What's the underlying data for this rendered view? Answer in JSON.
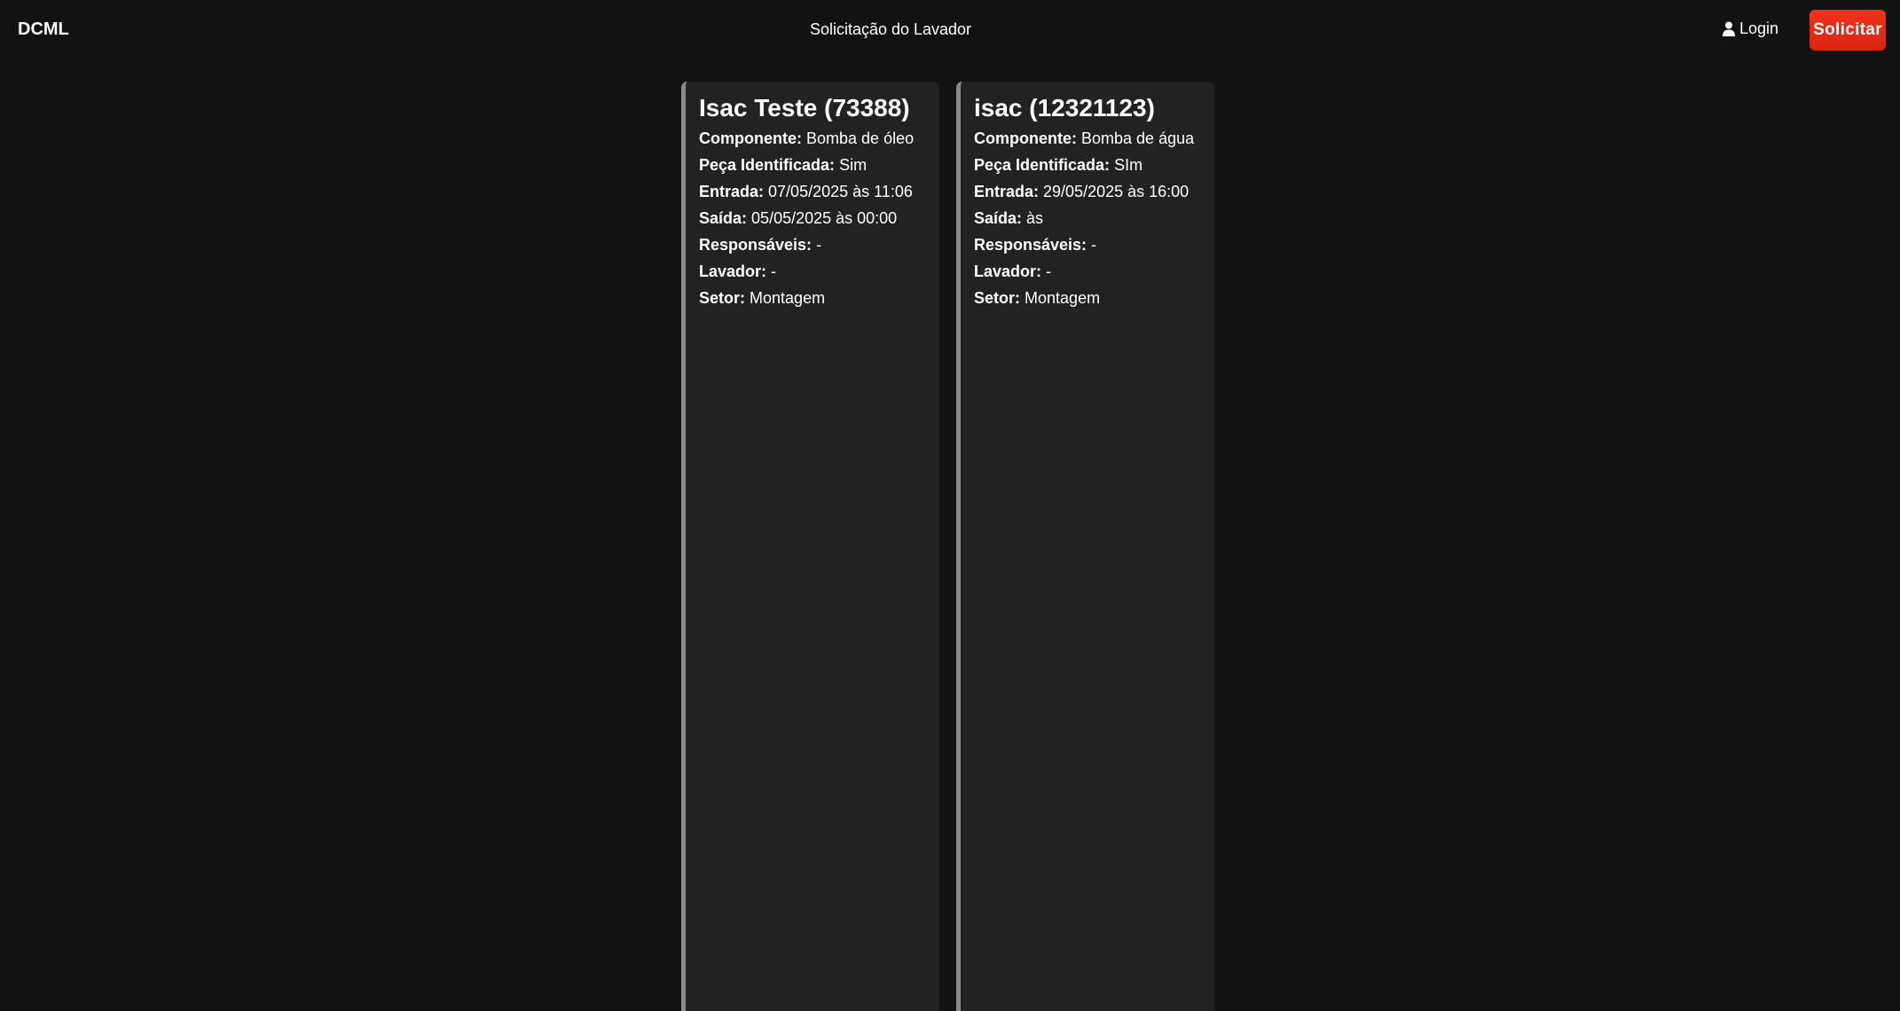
{
  "header": {
    "brand": "DCML",
    "title": "Solicitação do Lavador",
    "login_label": "Login",
    "login_icon": "user-icon",
    "request_button_label": "Solicitar",
    "request_button_color": "#e82a14"
  },
  "cards": [
    {
      "title": "Isac Teste (73388)",
      "fields": [
        {
          "label": "Componente:",
          "value": "Bomba de óleo"
        },
        {
          "label": "Peça Identificada:",
          "value": "Sim"
        },
        {
          "label": "Entrada:",
          "value": "07/05/2025 às 11:06"
        },
        {
          "label": "Saída:",
          "value": "05/05/2025 às 00:00"
        },
        {
          "label": "Responsáveis:",
          "value": "-"
        },
        {
          "label": "Lavador:",
          "value": "-"
        },
        {
          "label": "Setor:",
          "value": "Montagem"
        }
      ]
    },
    {
      "title": "isac (12321123)",
      "fields": [
        {
          "label": "Componente:",
          "value": "Bomba de água"
        },
        {
          "label": "Peça Identificada:",
          "value": "SIm"
        },
        {
          "label": "Entrada:",
          "value": "29/05/2025 às 16:00"
        },
        {
          "label": "Saída:",
          "value": "às"
        },
        {
          "label": "Responsáveis:",
          "value": "-"
        },
        {
          "label": "Lavador:",
          "value": "-"
        },
        {
          "label": "Setor:",
          "value": "Montagem"
        }
      ]
    }
  ],
  "colors": {
    "background": "#121212",
    "card_background": "#222222",
    "card_border": "#8a8a8a"
  }
}
